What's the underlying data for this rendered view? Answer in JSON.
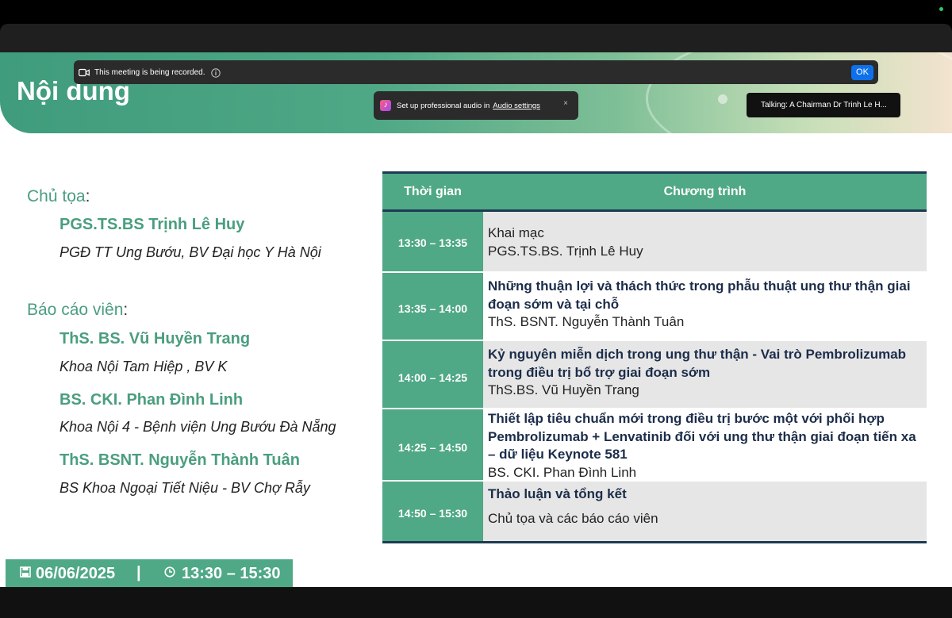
{
  "zoom": {
    "recording_text": "This meeting is being recorded.",
    "ok_label": "OK",
    "audio_popup_text": "Set up professional audio in",
    "audio_popup_link": "Audio settings",
    "audio_popup_close": "×",
    "talking_indicator": "Talking: A Chairman Dr Trinh Le H..."
  },
  "slide": {
    "title": "Nội dung",
    "chair_label": "Chủ tọa",
    "chair_name": "PGS.TS.BS Trịnh Lê Huy",
    "chair_affiliation": "PGĐ TT Ung Bướu, BV Đại học Y Hà Nội",
    "speakers_label": "Báo cáo viên",
    "speakers": [
      {
        "name": "ThS. BS. Vũ Huyền Trang",
        "affiliation": "Khoa Nội Tam Hiệp , BV K"
      },
      {
        "name": "BS. CKI.  Phan Đình Linh",
        "affiliation": "Khoa Nội 4 - Bệnh viện Ung Bướu Đà Nẵng"
      },
      {
        "name": "ThS. BSNT. Nguyễn Thành Tuân",
        "affiliation": "BS Khoa Ngoại Tiết Niệu - BV Chợ Rẫy"
      }
    ],
    "table": {
      "headers": [
        "Thời gian",
        "Chương trình"
      ],
      "rows": [
        {
          "time": "13:30 – 13:35",
          "topic": "Khai mạc",
          "presenter": "PGS.TS.BS. Trịnh Lê Huy"
        },
        {
          "time": "13:35 – 14:00",
          "topic": "Những thuận lợi và thách thức trong phẫu thuật ung thư thận giai đoạn sớm và tại chỗ",
          "presenter": "ThS. BSNT. Nguyễn Thành Tuân"
        },
        {
          "time": "14:00 – 14:25",
          "topic": "Kỷ nguyên miễn dịch trong ung thư thận - Vai trò Pembrolizumab trong điều trị bổ trợ giai đoạn sớm",
          "presenter": "ThS.BS. Vũ Huyền Trang"
        },
        {
          "time": "14:25 – 14:50",
          "topic": "Thiết lập tiêu chuẩn mới trong điều trị bước một với phối hợp Pembrolizumab + Lenvatinib đối với ung thư thận giai đoạn tiến xa – dữ liệu Keynote 581",
          "presenter": "BS. CKI. Phan Đình Linh"
        },
        {
          "time": "14:50 – 15:30",
          "topic": "Thảo luận và tổng kết",
          "presenter": "Chủ tọa và các báo cáo viên"
        }
      ]
    },
    "footer": {
      "date": "06/06/2025",
      "separator": "|",
      "time": "13:30 – 15:30"
    }
  },
  "colors": {
    "accent_green": "#4fa886",
    "navy": "#1c3b52",
    "zoom_blue": "#0e71eb"
  }
}
